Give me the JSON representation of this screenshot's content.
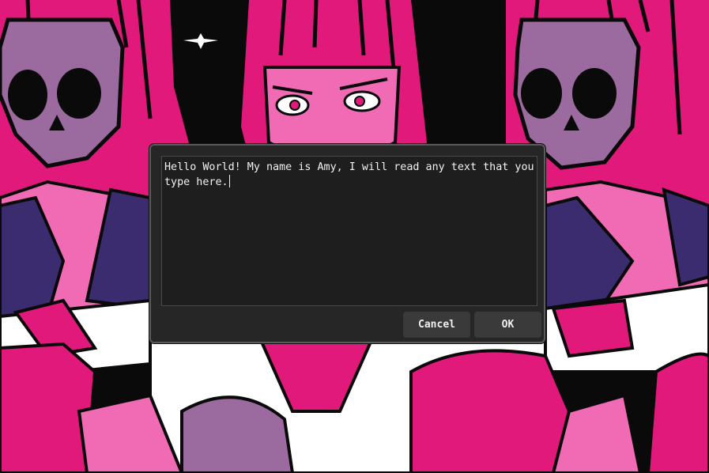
{
  "dialog": {
    "text_value": "Hello World! My name is Amy, I will read any text that you type here.",
    "cancel_label": "Cancel",
    "ok_label": "OK"
  },
  "background": {
    "description_colors": {
      "hair": "#e0197a",
      "skin": "#f06ab4",
      "skull": "#9b6a9e",
      "collar": "#3a2c6e",
      "outline": "#0a0a0a",
      "shirt": "#ffffff"
    }
  }
}
